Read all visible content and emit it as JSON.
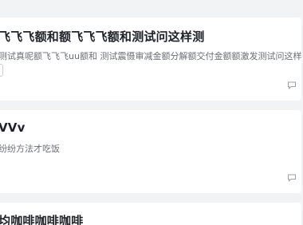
{
  "feed": {
    "posts": [
      {
        "title": "飞飞飞额和额飞飞飞额和测试问这样测",
        "excerpt": "测试真呢额飞飞飞uu额和 测试震慑审减金额分解额交付金额额激发测试问这样测试文具",
        "icon": "comment-icon"
      },
      {
        "title": "VVv",
        "excerpt": "纷纷方法才吃饭",
        "icon": "comment-icon"
      },
      {
        "title": "均咖啡咖啡咖啡"
      }
    ]
  }
}
